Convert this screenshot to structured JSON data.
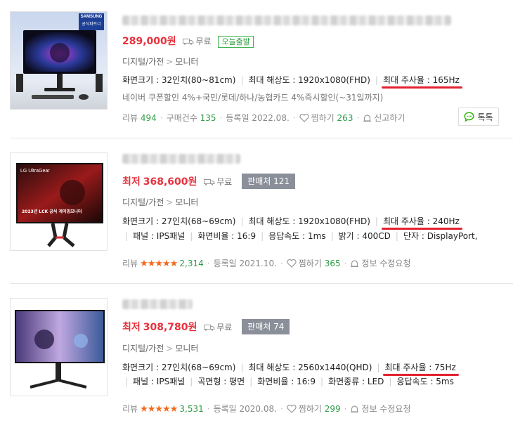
{
  "products": [
    {
      "price_prefix": "",
      "price": "289,000원",
      "shipping": "무료",
      "today_badge": "오늘출발",
      "sellers": "",
      "thumb_logo": "SAMSUNG",
      "thumb_tag": "공식파트너",
      "category": [
        "디지털/가전",
        "모니터"
      ],
      "specs_line1": [
        {
          "text": "화면크기 : 32인치(80~81cm)",
          "hl": false
        },
        {
          "text": "최대 해상도 : 1920x1080(FHD)",
          "hl": false
        },
        {
          "text": "최대 주사율 : 165Hz",
          "hl": true
        }
      ],
      "specs_line2": [],
      "promo": "네이버 쿠폰할인 4%+국민/롯데/하나/농협카드 4%즉시할인(~31일까지)",
      "meta": {
        "review_label": "리뷰",
        "review_count": "494",
        "stars": "",
        "purchase_label": "구매건수",
        "purchase_count": "135",
        "reg": "등록일 2022.08.",
        "zzim_label": "찜하기",
        "zzim_count": "263",
        "report": "신고하기"
      },
      "talk": "톡톡"
    },
    {
      "price_prefix": "최저",
      "price": "368,600원",
      "shipping": "무료",
      "today_badge": "",
      "sellers": "판매처 121",
      "thumb_logo": "LG UltraGear",
      "thumb_tag": "2023년 LCK 공식 게이밍모니터",
      "category": [
        "디지털/가전",
        "모니터"
      ],
      "specs_line1": [
        {
          "text": "화면크기 : 27인치(68~69cm)",
          "hl": false
        },
        {
          "text": "최대 해상도 : 1920x1080(FHD)",
          "hl": false
        },
        {
          "text": "최대 주사율 : 240Hz",
          "hl": true
        }
      ],
      "specs_line2": [
        "패널 : IPS패널",
        "화면비율 : 16:9",
        "응답속도 : 1ms",
        "밝기 : 400CD",
        "단자 : DisplayPort,"
      ],
      "promo": "",
      "meta": {
        "review_label": "리뷰",
        "review_count": "2,314",
        "stars": "★★★★★",
        "purchase_label": "",
        "purchase_count": "",
        "reg": "등록일 2021.10.",
        "zzim_label": "찜하기",
        "zzim_count": "365",
        "report": "정보 수정요청"
      },
      "talk": ""
    },
    {
      "price_prefix": "최저",
      "price": "308,780원",
      "shipping": "무료",
      "today_badge": "",
      "sellers": "판매처 74",
      "thumb_logo": "",
      "thumb_tag": "",
      "category": [
        "디지털/가전",
        "모니터"
      ],
      "specs_line1": [
        {
          "text": "화면크기 : 27인치(68~69cm)",
          "hl": false
        },
        {
          "text": "최대 해상도 : 2560x1440(QHD)",
          "hl": false
        },
        {
          "text": "최대 주사율 : 75Hz",
          "hl": true
        }
      ],
      "specs_line2": [
        "패널 : IPS패널",
        "곡면형 : 평면",
        "화면비율 : 16:9",
        "화면종류 : LED",
        "응답속도 : 5ms"
      ],
      "promo": "",
      "meta": {
        "review_label": "리뷰",
        "review_count": "3,531",
        "stars": "★★★★★",
        "purchase_label": "",
        "purchase_count": "",
        "reg": "등록일 2020.08.",
        "zzim_label": "찜하기",
        "zzim_count": "299",
        "report": "정보 수정요청"
      },
      "talk": ""
    }
  ]
}
